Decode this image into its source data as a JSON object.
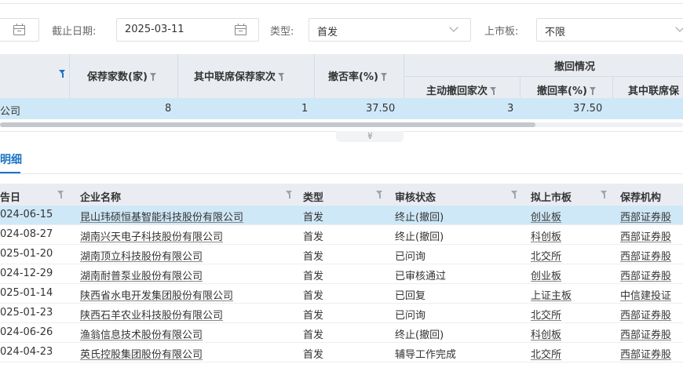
{
  "filters": {
    "deadline_label": "截止日期:",
    "deadline_value": "2025-03-11",
    "type_label": "类型:",
    "type_value": "首发",
    "board_label": "上市板:",
    "board_value": "不限"
  },
  "summary": {
    "headers": {
      "col1": "保荐家数(家)",
      "col2": "其中联席保荐家次",
      "col3": "撤否率(%)",
      "group": "撤回情况",
      "sub1": "主动撤回家次",
      "sub2": "撤回率(%)",
      "sub3": "其中联席保"
    },
    "row": {
      "name": "公司",
      "count": "8",
      "joint": "1",
      "reject_rate": "37.50",
      "withdraw_count": "3",
      "withdraw_rate": "37.50"
    },
    "collapse_icon": "≫"
  },
  "detail": {
    "tab_label": "明细",
    "headers": [
      "告日",
      "企业名称",
      "类型",
      "审核状态",
      "拟上市板",
      "保荐机构"
    ],
    "rows": [
      [
        "024-06-15",
        "昆山玮硕恒基智能科技股份有限公司",
        "首发",
        "终止(撤回)",
        "创业板",
        "西部证券股"
      ],
      [
        "024-08-27",
        "湖南兴天电子科技股份有限公司",
        "首发",
        "终止(撤回)",
        "科创板",
        "西部证券股"
      ],
      [
        "025-01-20",
        "湖南顶立科技股份有限公司",
        "首发",
        "已问询",
        "北交所",
        "西部证券股"
      ],
      [
        "024-12-29",
        "湖南耐普泵业股份有限公司",
        "首发",
        "已审核通过",
        "创业板",
        "西部证券股"
      ],
      [
        "025-01-14",
        "陕西省水电开发集团股份有限公司",
        "首发",
        "已回复",
        "上证主板",
        "中信建投证"
      ],
      [
        "025-01-23",
        "陕西石羊农业科技股份有限公司",
        "首发",
        "已问询",
        "北交所",
        "西部证券股"
      ],
      [
        "024-06-26",
        "渔翁信息技术股份有限公司",
        "首发",
        "终止(撤回)",
        "科创板",
        "西部证券股"
      ],
      [
        "024-04-23",
        "英氏控股集团股份有限公司",
        "首发",
        "辅导工作完成",
        "北交所",
        "西部证券股"
      ]
    ]
  },
  "icons": {
    "calendar": "calendar-icon",
    "dropdown": "chevron-down-icon",
    "filter": "filter-icon"
  },
  "colors": {
    "accent": "#1a73c6",
    "selected_row": "#cfe8f7",
    "header_bg": "#e9edf2"
  }
}
